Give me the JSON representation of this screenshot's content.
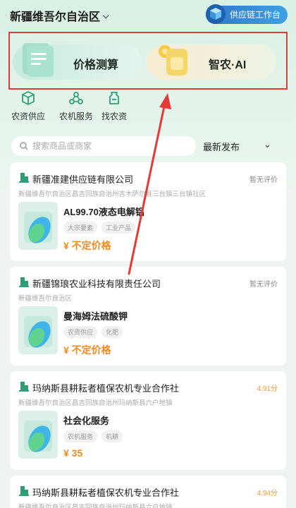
{
  "header": {
    "region": "新疆维吾尔自治区",
    "workbench": "供应链工作台"
  },
  "features": [
    {
      "label": "价格测算"
    },
    {
      "label": "智农·AI"
    }
  ],
  "nav": [
    {
      "label": "农资供应",
      "icon": "cube-icon"
    },
    {
      "label": "农机服务",
      "icon": "people-network-icon"
    },
    {
      "label": "找农资",
      "icon": "fertilizer-bag-icon"
    }
  ],
  "search": {
    "placeholder": "搜索商品或商家",
    "sort_label": "最新发布"
  },
  "listings": [
    {
      "company": "新疆准建供应链有限公司",
      "rating": "暂无评价",
      "address": "新疆维吾尔自治区昌吉回族自治州吉木萨尔县三台镇三台镇社区",
      "product": "AL99.70液态电解铝",
      "tags": [
        "大宗要素",
        "工业产品"
      ],
      "price": "¥ 不定价格"
    },
    {
      "company": "新疆锦琅农业科技有限责任公司",
      "rating": "暂无评价",
      "address": "新疆维吾尔自治区",
      "product": "曼海姆法硫酸钾",
      "tags": [
        "农资供应",
        "化肥"
      ],
      "price": "¥ 不定价格"
    },
    {
      "company": "玛纳斯县耕耘者植保农机专业合作社",
      "rating": "4.91分",
      "address": "新疆维吾尔自治区昌吉回族自治州玛纳斯县六户地镇",
      "product": "社会化服务",
      "tags": [
        "农机服务",
        "机耕"
      ],
      "price": "¥ 35"
    },
    {
      "company": "玛纳斯县耕耘者植保农机专业合作社",
      "rating": "4.94分",
      "address": "新疆维吾尔自治区昌吉回族自治州玛纳斯县六户地镇"
    }
  ],
  "colors": {
    "accent_green": "#2e9e74",
    "price_orange": "#f28a1c",
    "highlight_red": "#e53935",
    "workbench_blue": "#2f78c9"
  }
}
